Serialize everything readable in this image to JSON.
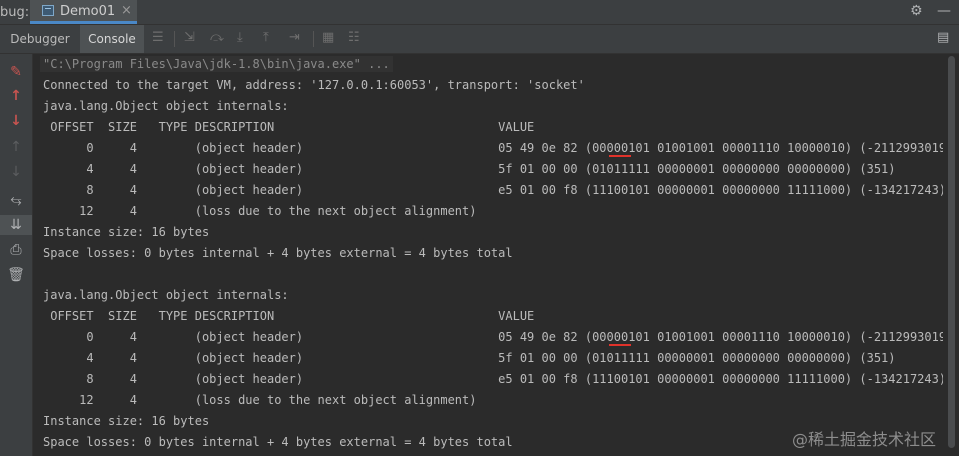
{
  "top_bar": {
    "debug_label": "bug:",
    "run_tab_label": "Demo01",
    "close_glyph": "×",
    "settings_icon": "⚙",
    "minimize_icon": "—"
  },
  "toolbar": {
    "tabs": [
      {
        "label": "Debugger"
      },
      {
        "label": "Console"
      }
    ],
    "icons": [
      "menu-icon",
      "show-execution-point-icon",
      "step-over-icon",
      "step-into-icon",
      "step-out-icon",
      "run-to-cursor-icon",
      "evaluate-expression-icon",
      "trace-icon",
      "layout-icon"
    ]
  },
  "console": {
    "lines": [
      "\"C:\\Program Files\\Java\\jdk-1.8\\bin\\java.exe\" ...",
      "Connected to the target VM, address: '127.0.0.1:60053', transport: 'socket'",
      "java.lang.Object object internals:",
      " OFFSET  SIZE   TYPE DESCRIPTION                               VALUE",
      "      0     4        (object header)                           05 49 0e 82 (00000101 01001001 00001110 10000010) (-2112993019)",
      "      4     4        (object header)                           5f 01 00 00 (01011111 00000001 00000000 00000000) (351)",
      "      8     4        (object header)                           e5 01 00 f8 (11100101 00000001 00000000 11111000) (-134217243)",
      "     12     4        (loss due to the next object alignment)",
      "Instance size: 16 bytes",
      "Space losses: 0 bytes internal + 4 bytes external = 4 bytes total",
      "",
      "java.lang.Object object internals:",
      " OFFSET  SIZE   TYPE DESCRIPTION                               VALUE",
      "      0     4        (object header)                           05 49 0e 82 (00000101 01001001 00001110 10000010) (-2112993019)",
      "      4     4        (object header)                           5f 01 00 00 (01011111 00000001 00000000 00000000) (351)",
      "      8     4        (object header)                           e5 01 00 f8 (11100101 00000001 00000000 11111000) (-134217243)",
      "     12     4        (loss due to the next object alignment)",
      "Instance size: 16 bytes",
      "Space losses: 0 bytes internal + 4 bytes external = 4 bytes total"
    ]
  },
  "watermark": "@稀土掘金技术社区",
  "colors": {
    "background": "#2b2b2b",
    "panel": "#3c3f41",
    "text": "#bbbbbb",
    "underline": "#e0322a",
    "tab_accent": "#4a88c7"
  }
}
